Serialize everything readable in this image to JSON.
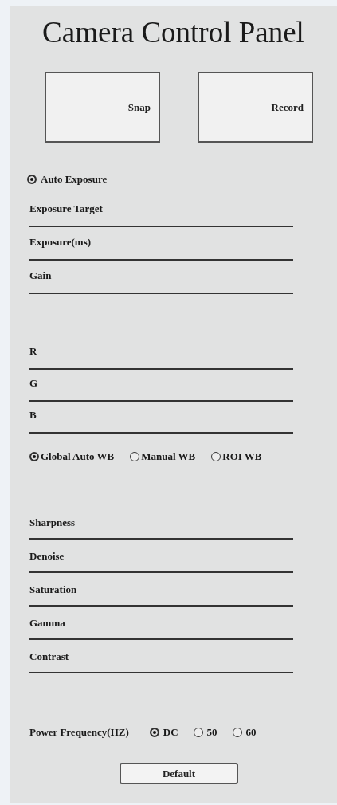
{
  "title": "Camera Control Panel",
  "action_buttons": [
    "Snap",
    "Record"
  ],
  "auto_exposure": {
    "label": "Auto Exposure",
    "selected": true
  },
  "exposure_sliders": [
    "Exposure Target",
    "Exposure(ms)",
    "Gain"
  ],
  "color_sliders": [
    "R",
    "G",
    "B"
  ],
  "wb_modes": [
    {
      "label": "Global Auto WB",
      "selected": true
    },
    {
      "label": "Manual WB",
      "selected": false
    },
    {
      "label": "ROI WB",
      "selected": false
    }
  ],
  "image_sliders": [
    "Sharpness",
    "Denoise",
    "Saturation",
    "Gamma",
    "Contrast"
  ],
  "power_frequency": {
    "label": "Power Frequency(HZ)",
    "options": [
      {
        "label": "DC",
        "selected": true
      },
      {
        "label": "50",
        "selected": false
      },
      {
        "label": "60",
        "selected": false
      }
    ]
  },
  "default_button": "Default"
}
